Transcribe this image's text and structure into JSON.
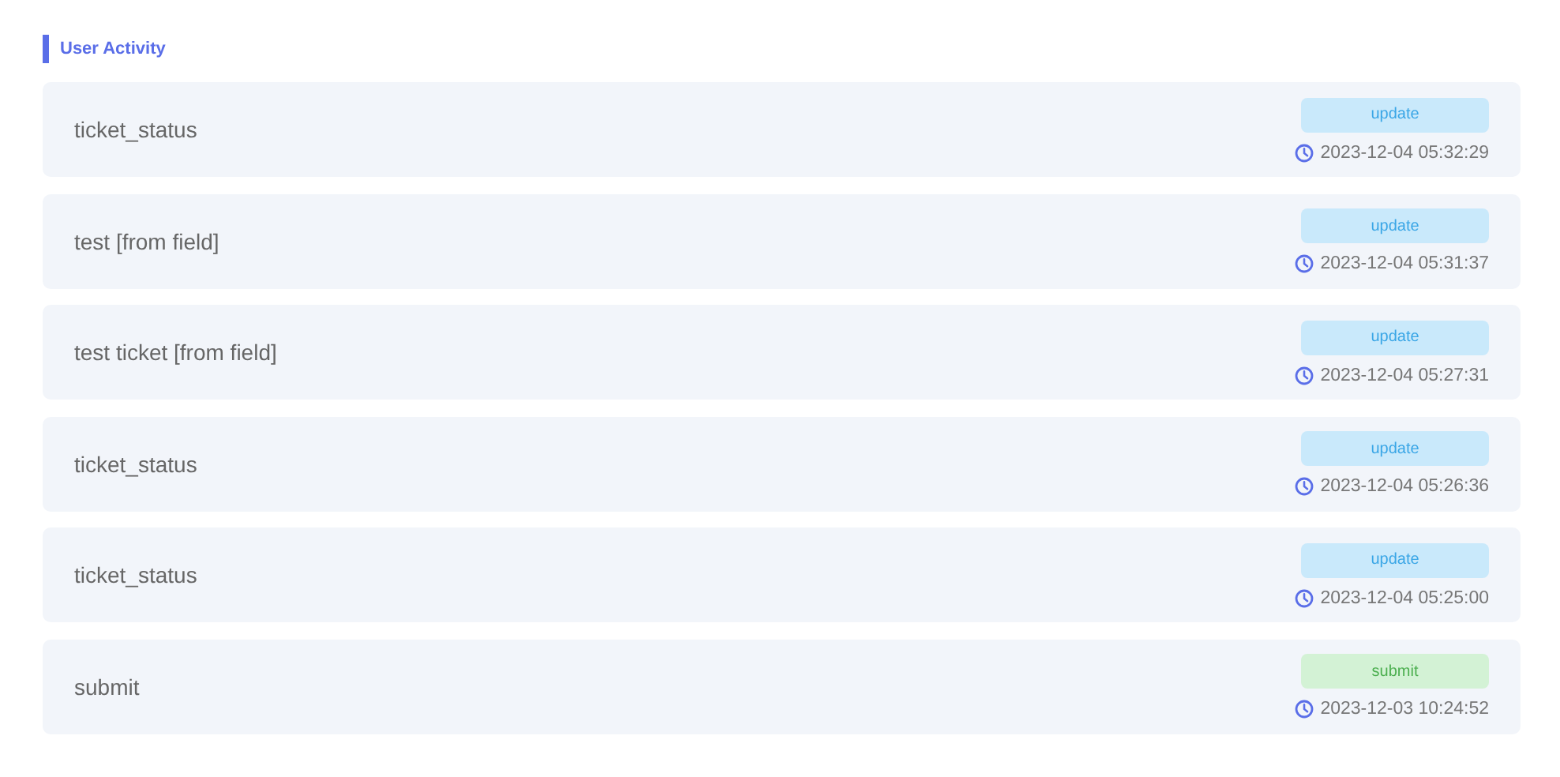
{
  "section_title": "User Activity",
  "activities": [
    {
      "name": "ticket_status",
      "action": {
        "label": "update",
        "kind": "update"
      },
      "time": "2023-12-04 05:32:29"
    },
    {
      "name": "test [from field]",
      "action": {
        "label": "update",
        "kind": "update"
      },
      "time": "2023-12-04 05:31:37"
    },
    {
      "name": "test ticket [from field]",
      "action": {
        "label": "update",
        "kind": "update"
      },
      "time": "2023-12-04 05:27:31"
    },
    {
      "name": "ticket_status",
      "action": {
        "label": "update",
        "kind": "update"
      },
      "time": "2023-12-04 05:26:36"
    },
    {
      "name": "ticket_status",
      "action": {
        "label": "update",
        "kind": "update"
      },
      "time": "2023-12-04 05:25:00"
    },
    {
      "name": "submit",
      "action": {
        "label": "submit",
        "kind": "submit"
      },
      "time": "2023-12-03 10:24:52"
    }
  ]
}
